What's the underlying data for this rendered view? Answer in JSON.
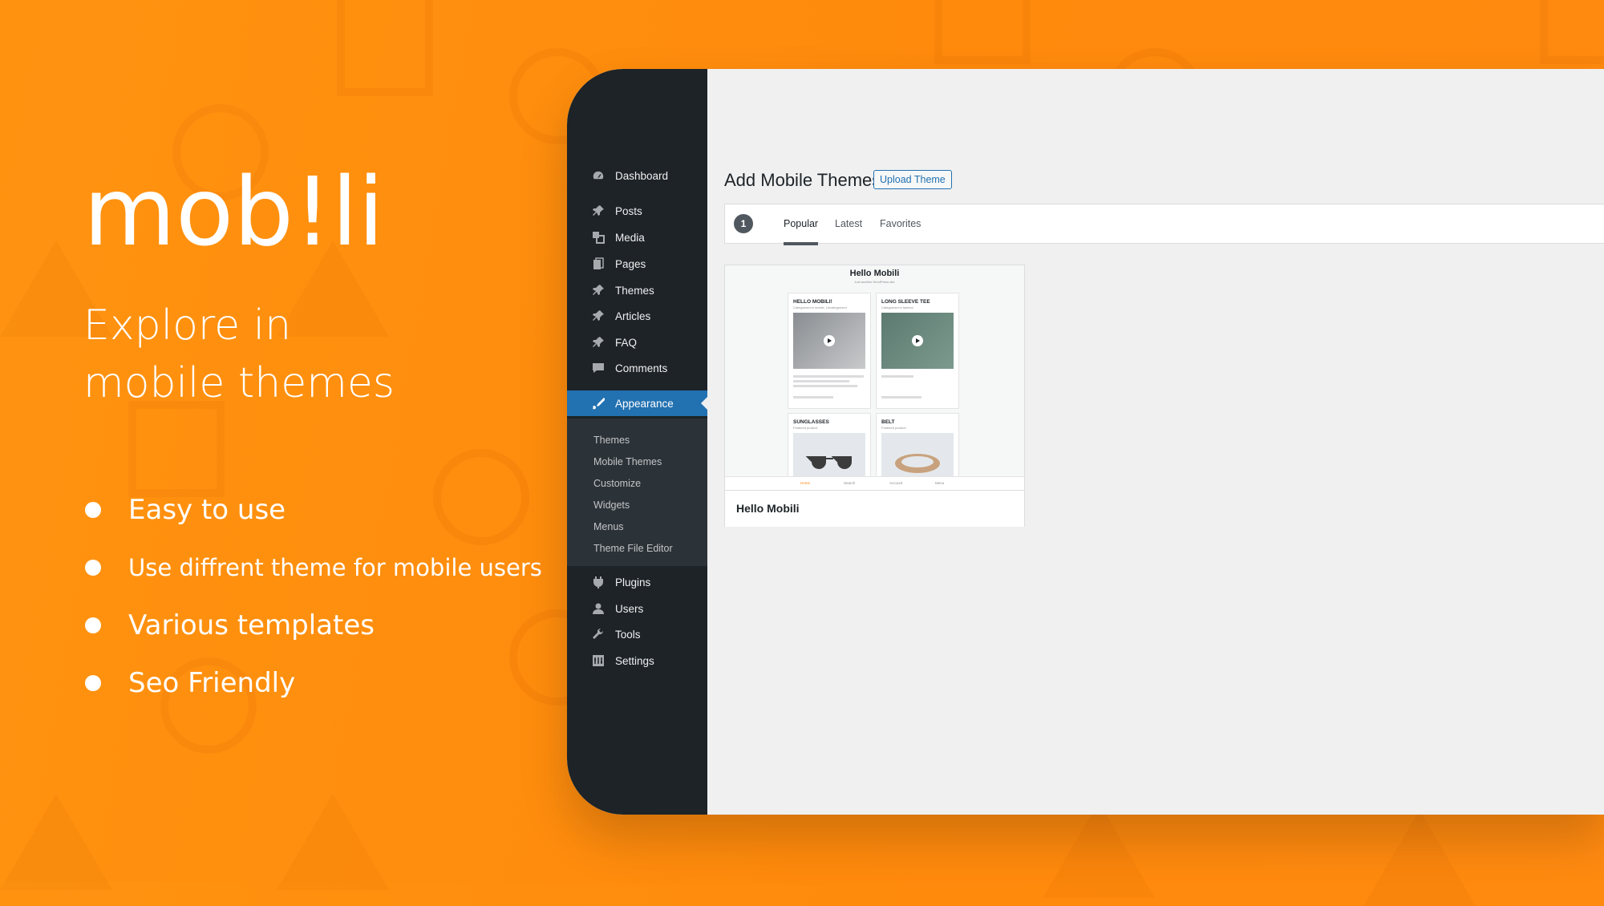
{
  "promo": {
    "logo": "mob!li",
    "headline_line1": "Explore in",
    "headline_line2": "mobile themes",
    "features": [
      "Easy to use",
      "Use diffrent theme for mobile users",
      "Various templates",
      "Seo Friendly"
    ]
  },
  "admin": {
    "menu": {
      "dashboard": "Dashboard",
      "posts": "Posts",
      "media": "Media",
      "pages": "Pages",
      "themes": "Themes",
      "articles": "Articles",
      "faq": "FAQ",
      "comments": "Comments",
      "appearance": "Appearance",
      "plugins": "Plugins",
      "users": "Users",
      "tools": "Tools",
      "settings": "Settings"
    },
    "submenu": [
      "Themes",
      "Mobile Themes",
      "Customize",
      "Widgets",
      "Menus",
      "Theme File Editor"
    ],
    "page_title": "Add Mobile Themes",
    "upload_button": "Upload Theme",
    "filter_count": "1",
    "tabs": [
      "Popular",
      "Latest",
      "Favorites"
    ],
    "active_tab": "Popular",
    "theme_card": {
      "name": "Hello Mobili",
      "screenshot": {
        "title": "Hello Mobili",
        "subtitle": "Just another WordPress site",
        "items": [
          {
            "title": "HELLO MOBILI!",
            "subtitle": "Categorized in mobile, Uncategorized"
          },
          {
            "title": "LONG SLEEVE TEE",
            "subtitle": "Categorized in fashion"
          },
          {
            "title": "SUNGLASSES",
            "subtitle": "Featured product"
          },
          {
            "title": "BELT",
            "subtitle": "Featured product"
          }
        ],
        "nav": [
          "Home",
          "Search",
          "Account",
          "Menu"
        ]
      }
    }
  },
  "colors": {
    "background_orange": "#ff8a0c",
    "sidebar_dark": "#1d2327",
    "accent_blue": "#2271b1"
  }
}
